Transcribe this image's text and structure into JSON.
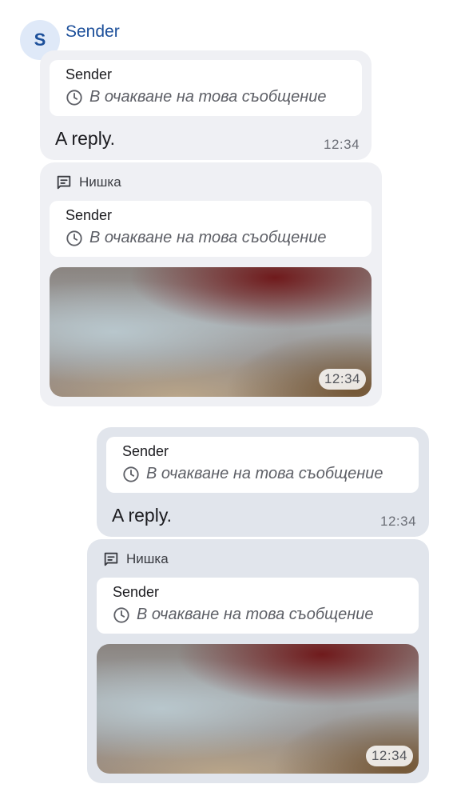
{
  "incoming": {
    "avatar_letter": "S",
    "sender_name": "Sender",
    "reply_message": {
      "quote_sender": "Sender",
      "quote_status": "В очакване на това съобщение",
      "text": "A reply.",
      "time": "12:34"
    },
    "thread_message": {
      "thread_label": "Нишка",
      "quote_sender": "Sender",
      "quote_status": "В очакване на това съобщение",
      "time": "12:34"
    }
  },
  "outgoing": {
    "reply_message": {
      "quote_sender": "Sender",
      "quote_status": "В очакване на това съобщение",
      "text": "A reply.",
      "time": "12:34"
    },
    "thread_message": {
      "thread_label": "Нишка",
      "quote_sender": "Sender",
      "quote_status": "В очакване на това съобщение",
      "time": "12:34"
    }
  }
}
